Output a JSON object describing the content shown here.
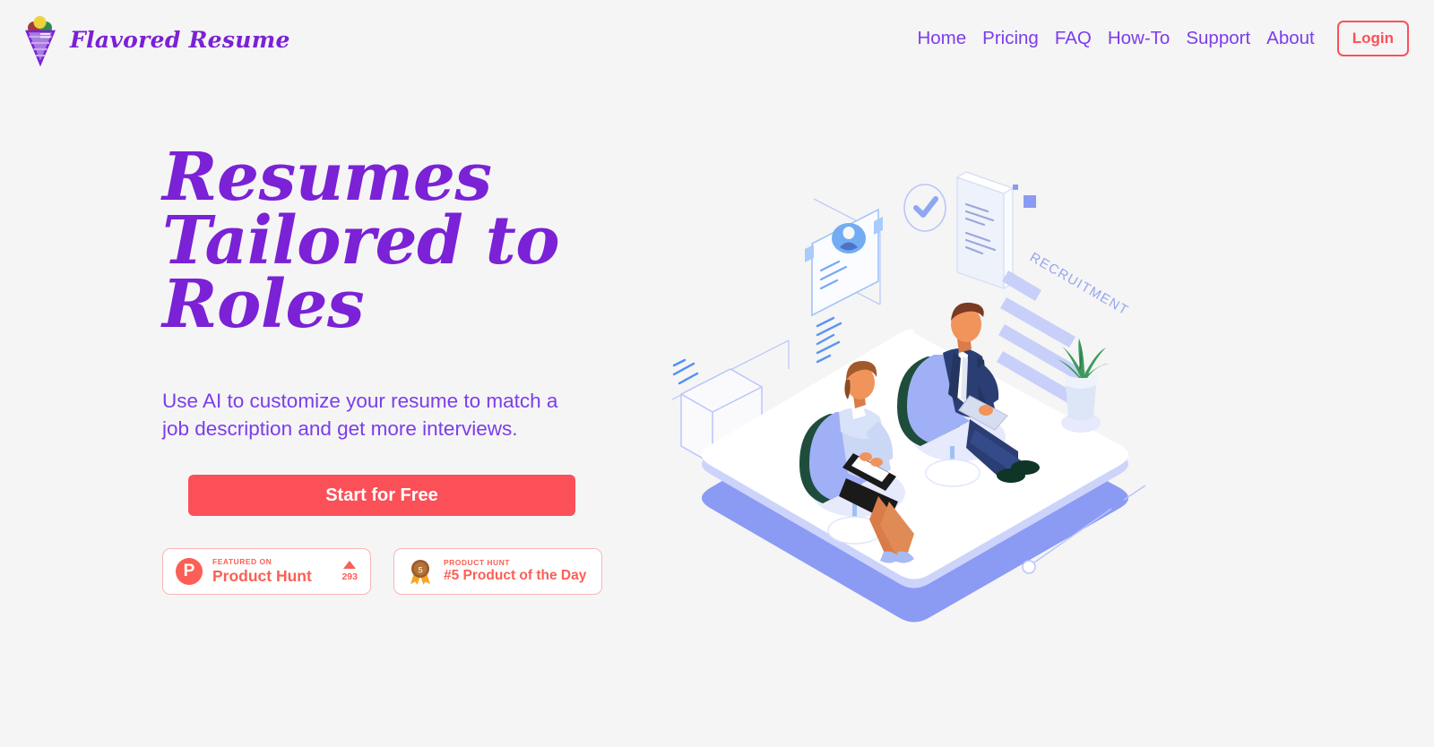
{
  "header": {
    "logo_icon": "snow-cone-icon",
    "brand_name": "Flavored Resume",
    "nav_items": [
      {
        "label": "Home"
      },
      {
        "label": "Pricing"
      },
      {
        "label": "FAQ"
      },
      {
        "label": "How-To"
      },
      {
        "label": "Support"
      },
      {
        "label": "About"
      }
    ],
    "login_label": "Login"
  },
  "hero": {
    "headline": "Resumes\nTailored to Roles",
    "subhead": "Use AI to customize your resume to match a\njob description and get more interviews.",
    "cta_label": "Start for Free"
  },
  "badges": [
    {
      "icon": "product-hunt-p-icon",
      "mark": "P",
      "kicker": "FEATURED ON",
      "title": "Product Hunt",
      "vote_icon": "upvote-triangle-icon",
      "vote_count": "293"
    },
    {
      "icon": "bronze-medal-icon",
      "medal_rank": "5",
      "kicker": "PRODUCT HUNT",
      "title": "#5 Product of the Day"
    }
  ],
  "illustration": {
    "name": "isometric-recruitment-interview-illustration",
    "label_recruitment": "RECRUITMENT",
    "elements": [
      "profile-card-icon",
      "checkmark-circle-icon",
      "document-icon",
      "envelope-icon",
      "potted-plant-icon",
      "seated-woman-figure",
      "seated-man-figure",
      "isometric-platform"
    ]
  },
  "colors": {
    "page_background": "#f5f5f5",
    "brand_purple": "#7B21D6",
    "nav_purple": "#7C3DEB",
    "accent_coral": "#FB5058",
    "badge_coral": "#FB5F55",
    "badge_border": "#F8B6B4",
    "illustration_periwinkle": "#8B9BF4",
    "illustration_navy": "#2B3E74",
    "illustration_skin": "#F0945C",
    "illustration_green": "#1E4D3B"
  }
}
